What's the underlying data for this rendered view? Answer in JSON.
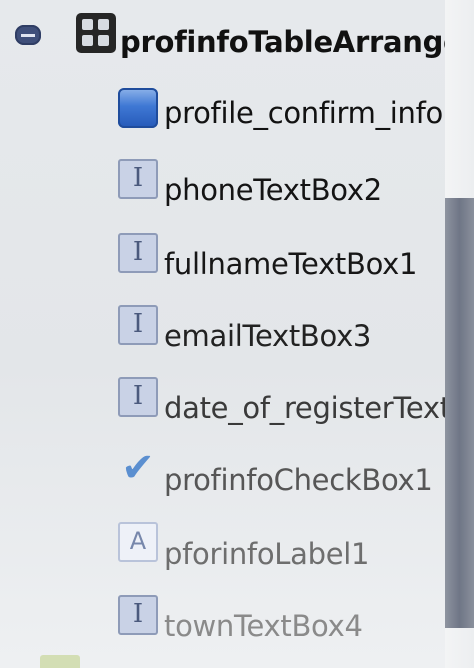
{
  "tree": {
    "root": {
      "label": "profinfoTableArrangen",
      "icon": "table-arrangement-icon",
      "expanded": true,
      "toggle_icon": "collapse-minus-icon"
    },
    "children": [
      {
        "label": "profile_confirm_info",
        "icon": "button-icon",
        "text_color": "#121212"
      },
      {
        "label": "phoneTextBox2",
        "icon": "textbox-icon",
        "glyph": "I",
        "text_color": "#141414"
      },
      {
        "label": "fullnameTextBox1",
        "icon": "textbox-icon",
        "glyph": "I",
        "text_color": "#171717"
      },
      {
        "label": "emailTextBox3",
        "icon": "textbox-icon",
        "glyph": "I",
        "text_color": "#222222"
      },
      {
        "label": "date_of_registerTextBox",
        "icon": "textbox-icon",
        "glyph": "I",
        "text_color": "#3a3a3a"
      },
      {
        "label": "profinfoCheckBox1",
        "icon": "checkbox-icon",
        "glyph": "✔",
        "text_color": "#565656"
      },
      {
        "label": "pforinfoLabel1",
        "icon": "label-icon",
        "glyph": "A",
        "text_color": "#6e6e6e"
      },
      {
        "label": "townTextBox4",
        "icon": "textbox-icon",
        "glyph": "I",
        "text_color": "#8a8a8a"
      }
    ]
  },
  "colors": {
    "background": "#e5e8eb",
    "scrollbar_thumb": "#777e8c",
    "toggle": "#3f4f7a"
  }
}
